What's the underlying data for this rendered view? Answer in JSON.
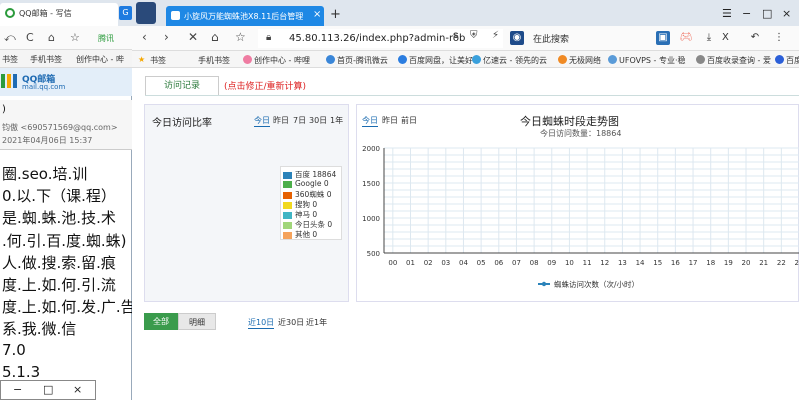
{
  "left_window": {
    "tab_title": "QQ邮箱 - 写信",
    "newtab_label": "G",
    "toolbar": [
      "⤺",
      "C",
      "⌂",
      "☆",
      "腾讯"
    ],
    "bookmarks": [
      "书签",
      "手机书签",
      "创作中心 - 哔"
    ],
    "mail_logo_line1": "QQ邮箱",
    "mail_logo_line2": "mail.qq.com",
    "meta_line1": ")",
    "meta_line2": "钧傲 <690571569@qq.com>",
    "meta_line3": "2021年04月06日 15:37",
    "content_lines": [
      "圈.seo.培.训",
      "0.以.下（课.程）",
      "是.蜘.蛛.池.技.术",
      ".何.引.百.度.蜘.蛛)",
      "人.做.搜.索.留.痕",
      "度.上.如.何.引.流",
      "度.上.如.何.发.广.告",
      "系.我.微.信",
      "7.0",
      "5.1.3"
    ],
    "bottom_controls": [
      "−",
      "□",
      "×"
    ]
  },
  "browser": {
    "tab_title": "小旋风万能蜘蛛池X8.11后台管理",
    "tab_close": "×",
    "newtab": "+",
    "window_controls": [
      "☰",
      "−",
      "□",
      "×"
    ],
    "address": "45.80.113.26/index.php?admin-rob",
    "search_placeholder": "在此搜索",
    "zoom": "X",
    "bookmarks": [
      "书签",
      "手机书签",
      "创作中心 - 哔哩",
      "首页-腾讯微云",
      "百度网盘，让美好",
      "亿速云 - 领先的云",
      "无极网络",
      "UFOVPS - 专业·稳",
      "百度收录查询 - 爱",
      "百度"
    ]
  },
  "page": {
    "tab_visit": "访问记录",
    "tab_fix": "(点击修正/重新计算)",
    "left_panel": {
      "title": "今日访问比率",
      "links": [
        "今日",
        "昨日",
        "7日",
        "30日",
        "1年"
      ],
      "legend": [
        {
          "label": "百度 18864",
          "color": "#2b83ba"
        },
        {
          "label": "Google 0",
          "color": "#4daf4a"
        },
        {
          "label": "360蜘蛛 0",
          "color": "#e66101"
        },
        {
          "label": "搜狗 0",
          "color": "#f1d91f"
        },
        {
          "label": "神马 0",
          "color": "#40b5c4"
        },
        {
          "label": "今日头条 0",
          "color": "#a1d67a"
        },
        {
          "label": "其他 0",
          "color": "#f5a35c"
        }
      ]
    },
    "right_panel": {
      "links": [
        "今日",
        "昨日",
        "前日"
      ],
      "title": "今日蜘蛛时段走势图",
      "subtitle": "今日访问数量：18864",
      "legend_label": "蜘蛛访问次数（次/小时）"
    },
    "bottom": {
      "btn_all": "全部",
      "btn_detail": "明细",
      "links": [
        "近10日",
        "近30日",
        "近1年"
      ]
    }
  },
  "chart_data": {
    "type": "line",
    "title": "今日蜘蛛时段走势图",
    "subtitle": "今日访问数量：18864",
    "x": [
      "00",
      "01",
      "02",
      "03",
      "04",
      "05",
      "06",
      "07",
      "08",
      "09",
      "10",
      "11",
      "12",
      "13",
      "14",
      "15",
      "16",
      "17",
      "18",
      "19",
      "20",
      "21",
      "22",
      "23"
    ],
    "ylim": [
      500,
      2000
    ],
    "yticks": [
      500,
      1000,
      1500,
      2000
    ],
    "grid": true,
    "legend": "bottom",
    "series": [
      {
        "name": "蜘蛛访问次数（次/小时）",
        "values": []
      }
    ]
  },
  "colors": {
    "accent": "#1e88e5",
    "tab_fix": "#dd2222",
    "btn_all": "#3a9b4c",
    "grid": "#dde8f0"
  }
}
